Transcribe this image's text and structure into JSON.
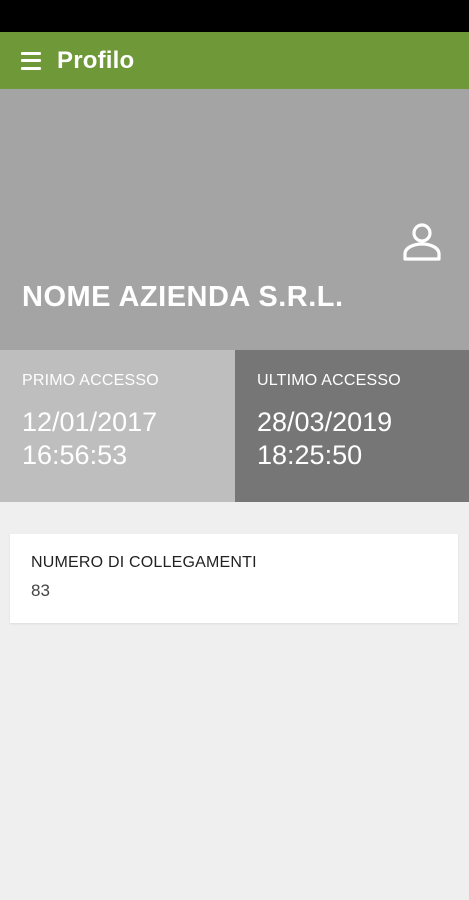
{
  "colors": {
    "app_bar": "#6f9838",
    "header_bg": "#a4a4a4",
    "first_access_bg": "#bebebe",
    "last_access_bg": "#767676"
  },
  "app_bar": {
    "menu_icon": "hamburger-menu-icon",
    "title": "Profilo"
  },
  "profile": {
    "avatar_icon": "person-icon",
    "company_name": "NOME AZIENDA S.R.L."
  },
  "access": {
    "first": {
      "label": "PRIMO ACCESSO",
      "date": "12/01/2017",
      "time": "16:56:53"
    },
    "last": {
      "label": "ULTIMO ACCESSO",
      "date": "28/03/2019",
      "time": "18:25:50"
    }
  },
  "connections": {
    "label": "NUMERO DI COLLEGAMENTI",
    "value": "83"
  }
}
